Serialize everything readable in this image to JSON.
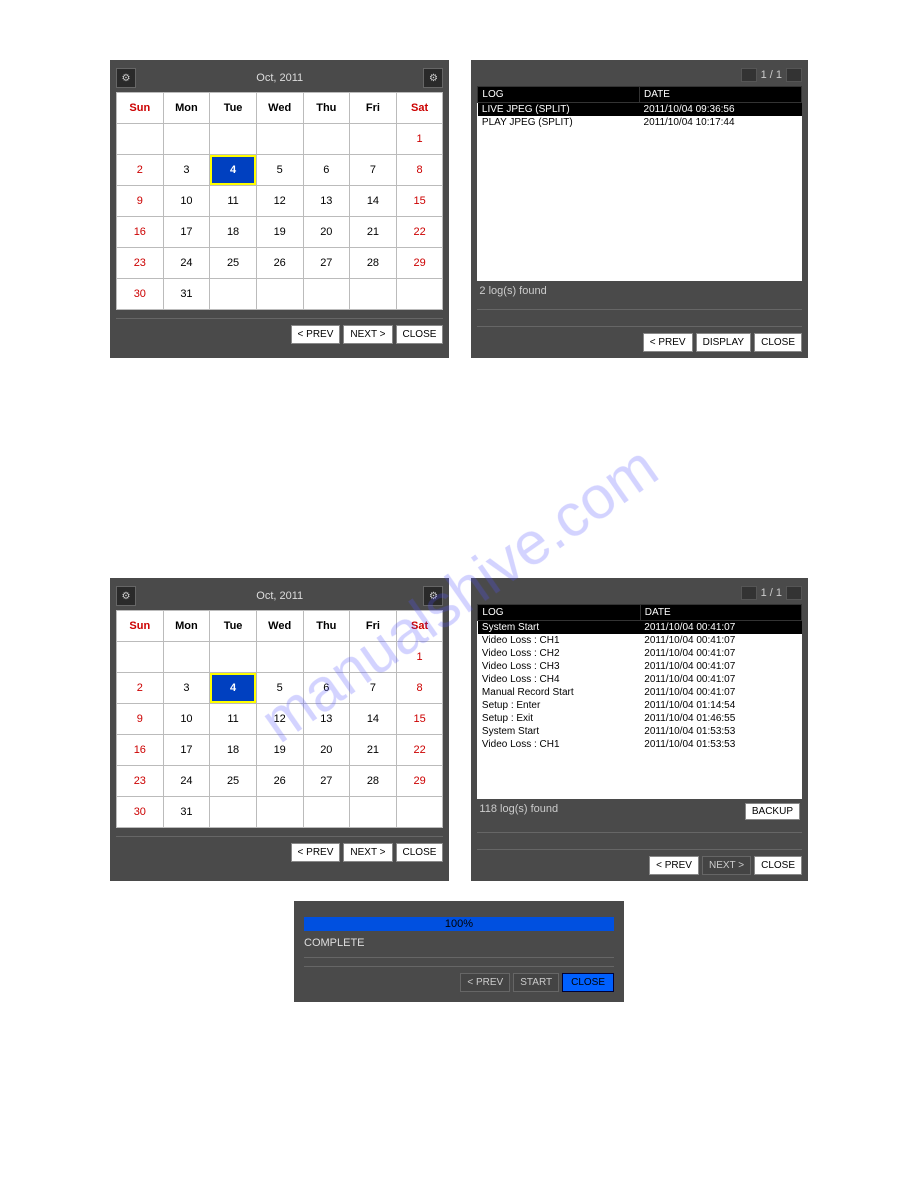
{
  "cal": {
    "title": "Oct, 2011",
    "days": [
      "Sun",
      "Mon",
      "Tue",
      "Wed",
      "Thu",
      "Fri",
      "Sat"
    ],
    "rows": [
      [
        "",
        "",
        "",
        "",
        "",
        "",
        "1"
      ],
      [
        "2",
        "3",
        "4",
        "5",
        "6",
        "7",
        "8"
      ],
      [
        "9",
        "10",
        "11",
        "12",
        "13",
        "14",
        "15"
      ],
      [
        "16",
        "17",
        "18",
        "19",
        "20",
        "21",
        "22"
      ],
      [
        "23",
        "24",
        "25",
        "26",
        "27",
        "28",
        "29"
      ],
      [
        "30",
        "31",
        "",
        "",
        "",
        "",
        ""
      ]
    ],
    "selected": "4",
    "prev": "< PREV",
    "next": "NEXT >",
    "close": "CLOSE"
  },
  "log1": {
    "cols": [
      "LOG",
      "DATE"
    ],
    "rows": [
      [
        "LIVE JPEG (SPLIT)",
        "2011/10/04 09:36:56"
      ],
      [
        "PLAY JPEG (SPLIT)",
        "2011/10/04 10:17:44"
      ]
    ],
    "status": "2 log(s) found",
    "pager": "1 / 1",
    "prev": "< PREV",
    "display": "DISPLAY",
    "close": "CLOSE"
  },
  "log2": {
    "cols": [
      "LOG",
      "DATE"
    ],
    "rows": [
      [
        "System Start",
        "2011/10/04 00:41:07"
      ],
      [
        "Video Loss : CH1",
        "2011/10/04 00:41:07"
      ],
      [
        "Video Loss : CH2",
        "2011/10/04 00:41:07"
      ],
      [
        "Video Loss : CH3",
        "2011/10/04 00:41:07"
      ],
      [
        "Video Loss : CH4",
        "2011/10/04 00:41:07"
      ],
      [
        "Manual Record Start",
        "2011/10/04 00:41:07"
      ],
      [
        "Setup : Enter",
        "2011/10/04 01:14:54"
      ],
      [
        "Setup : Exit",
        "2011/10/04 01:46:55"
      ],
      [
        "System Start",
        "2011/10/04 01:53:53"
      ],
      [
        "Video Loss : CH1",
        "2011/10/04 01:53:53"
      ]
    ],
    "status": "118 log(s) found",
    "backup": "BACKUP",
    "pager": "1 / 1",
    "prev": "< PREV",
    "next": "NEXT >",
    "close": "CLOSE"
  },
  "prog": {
    "pct": "100%",
    "text": "COMPLETE",
    "prev": "< PREV",
    "start": "START",
    "close": "CLOSE"
  },
  "watermark": "manualshive.com"
}
